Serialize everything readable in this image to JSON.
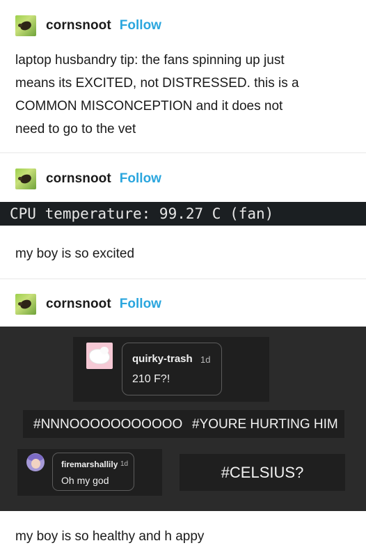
{
  "posts": [
    {
      "username": "cornsnoot",
      "follow_label": "Follow",
      "text_lines": [
        "laptop husbandry tip: the fans spinning up just",
        "means its EXCITED, not DISTRESSED. this is a",
        "COMMON MISCONCEPTION and it does not",
        "need to go to the vet"
      ]
    },
    {
      "username": "cornsnoot",
      "follow_label": "Follow",
      "terminal_text": "CPU temperature: 99.27 C (fan)",
      "text": "my boy is  so excited"
    },
    {
      "username": "cornsnoot",
      "follow_label": "Follow",
      "reply1": {
        "user": "quirky-trash",
        "time": "1d",
        "message": "210 F?!"
      },
      "tags": [
        "#NNNOOOOOOOOOOO",
        "#YOURE HURTING HIM"
      ],
      "reply2": {
        "user": "firemarshallily",
        "time": "1d",
        "message": "Oh my god"
      },
      "celsius_tag": "#CELSIUS?",
      "text": "my boy is so healthy and h appy"
    }
  ],
  "colors": {
    "follow_link": "#2ba6de",
    "dark_panel": "#2b2b2b",
    "terminal_bg": "#1b1f22"
  }
}
